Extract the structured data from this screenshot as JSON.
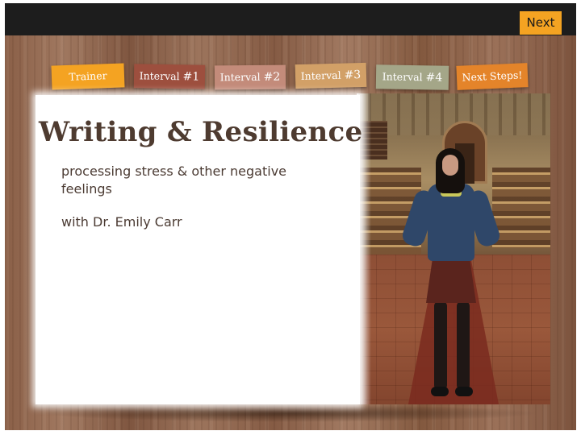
{
  "header": {
    "next_label": "Next"
  },
  "tabs": [
    {
      "label": "Trainer",
      "num": ""
    },
    {
      "label": "Interval ",
      "num": "#1"
    },
    {
      "label": "Interval ",
      "num": "#2"
    },
    {
      "label": "Interval ",
      "num": "#3"
    },
    {
      "label": "Interval ",
      "num": "#4"
    },
    {
      "label": "Next Steps!",
      "num": ""
    }
  ],
  "card": {
    "title": "Writing & Resilience",
    "subtitle": "processing stress & other negative feelings",
    "byline": "with Dr. Emily Carr"
  },
  "colors": {
    "accent": "#f4a322",
    "topbar": "#1d1d1d",
    "title_text": "#4e3b30",
    "tab_trainer": "#f4a322",
    "tab_interval_1": "#9d4f3e",
    "tab_interval_2": "#c38b7a",
    "tab_interval_3": "#d2a067",
    "tab_interval_4": "#a4a688",
    "tab_next_steps": "#e4842a"
  }
}
